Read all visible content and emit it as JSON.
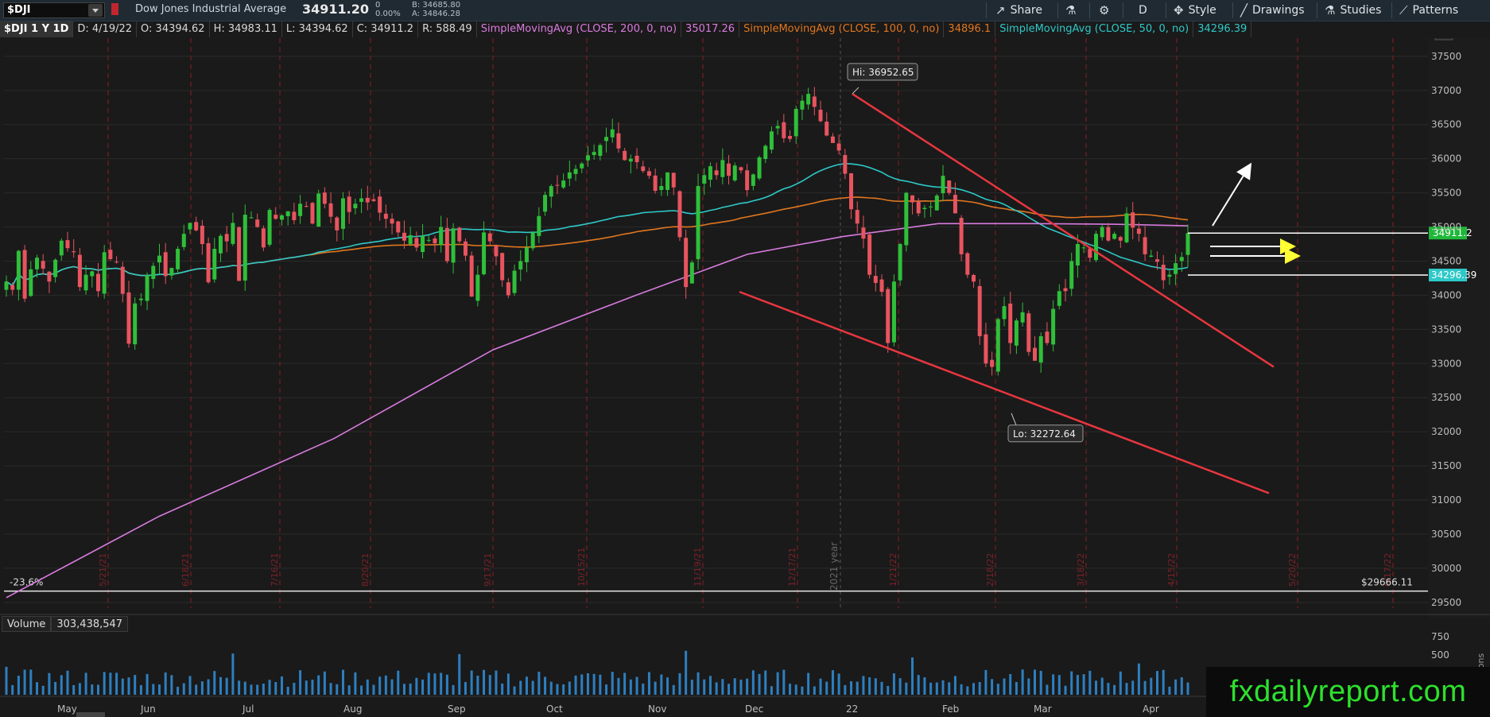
{
  "header": {
    "symbol": "$DJI",
    "name": "Dow Jones Industrial Average",
    "last": "34911.20",
    "change": "0",
    "change_pct": "0.00%",
    "bid": "B: 34685.80",
    "ask": "A: 34846.28",
    "buttons": {
      "share": "Share",
      "period": "D",
      "style": "Style",
      "drawings": "Drawings",
      "studies": "Studies",
      "patterns": "Patterns"
    }
  },
  "infobar": {
    "symbol": "$DJI 1 Y 1D",
    "date": "D: 4/19/22",
    "open": "O: 34394.62",
    "high": "H: 34983.11",
    "low": "L: 34394.62",
    "close": "C: 34911.2",
    "range": "R: 588.49",
    "sma200_label": "SimpleMovingAvg (CLOSE, 200, 0, no)",
    "sma200_value": "35017.26",
    "sma100_label": "SimpleMovingAvg (CLOSE, 100, 0, no)",
    "sma100_value": "34896.1",
    "sma50_label": "SimpleMovingAvg (CLOSE, 50, 0, no)",
    "sma50_value": "34296.39"
  },
  "volume": {
    "label": "Volume",
    "value": "303,438,547"
  },
  "watermark": "fxdailyreport.com",
  "colors": {
    "up": "#2fbf3a",
    "down": "#e8545f",
    "sma200": "#d97be0",
    "sma100": "#e0761f",
    "sma50": "#2ec8c8",
    "trend": "#e8363f",
    "volume": "#2d7fc0",
    "arrow": "#ffff33"
  },
  "chart_data": {
    "type": "candlestick",
    "y_ticks": [
      29500,
      30000,
      30500,
      31000,
      31500,
      32000,
      32500,
      33000,
      33500,
      34000,
      34500,
      35000,
      35500,
      36000,
      36500,
      37000,
      37500
    ],
    "ylim": [
      29300,
      37650
    ],
    "x_months": [
      "May",
      "Jun",
      "Jul",
      "Aug",
      "Sep",
      "Oct",
      "Nov",
      "Dec",
      "22",
      "Feb",
      "Mar",
      "Apr"
    ],
    "x_dates_vertical": [
      "5/21/21",
      "6/18/21",
      "7/16/21",
      "8/20/21",
      "9/17/21",
      "10/15/21",
      "11/19/21",
      "12/17/21",
      "1/21/22",
      "2/18/22",
      "3/18/22",
      "4/15/22",
      "5/20/22",
      "6/17/22"
    ],
    "year_marker": "2021 year",
    "high_label": "Hi: 36952.65",
    "low_label": "Lo: 32272.64",
    "fib_label": "-23.6%",
    "fib_value": "$29666.11",
    "last_price_tag": "34911.2",
    "sma50_tag": "34296.39",
    "vol_ticks": [
      "750",
      "500"
    ],
    "vol_unit": "Millions",
    "daily_closes": [
      34200,
      34080,
      34650,
      33950,
      34380,
      34550,
      34390,
      34200,
      34520,
      34800,
      34690,
      34630,
      34120,
      34300,
      34350,
      34060,
      34630,
      34530,
      34480,
      34020,
      33290,
      33880,
      33950,
      34290,
      34430,
      34580,
      34280,
      34400,
      34680,
      34900,
      35060,
      34950,
      34750,
      34190,
      34680,
      34870,
      34790,
      35060,
      34210,
      35180,
      35140,
      35000,
      34700,
      35250,
      35120,
      35170,
      35230,
      35100,
      35340,
      35300,
      35050,
      35490,
      35340,
      35150,
      34950,
      35420,
      35220,
      35340,
      35420,
      35360,
      35380,
      35210,
      35120,
      35050,
      34920,
      34800,
      34880,
      34700,
      34870,
      34810,
      34760,
      35000,
      34500,
      34980,
      34790,
      34580,
      33980,
      34300,
      34920,
      34790,
      34570,
      34220,
      34000,
      34360,
      34500,
      34700,
      34920,
      35160,
      35470,
      35600,
      35610,
      35680,
      35800,
      35850,
      35930,
      36050,
      36100,
      36200,
      36320,
      36430,
      36150,
      35980,
      36000,
      35950,
      35820,
      35750,
      35530,
      35600,
      35800,
      35580,
      34850,
      34120,
      34480,
      35600,
      35760,
      35890,
      35760,
      35980,
      35750,
      35900,
      35830,
      35540,
      35770,
      36020,
      36190,
      36400,
      36480,
      36300,
      36290,
      36730,
      36850,
      36950,
      36760,
      36550,
      36340,
      36230,
      36120,
      35780,
      35260,
      35050,
      34830,
      34300,
      34180,
      34050,
      33300,
      34200,
      34750,
      35500,
      35360,
      35200,
      35280,
      35300,
      35460,
      35750,
      35500,
      35200,
      34600,
      34300,
      34200,
      33400,
      33000,
      32950,
      33650,
      33840,
      33300,
      33630,
      33750,
      33170,
      33040,
      33400,
      33300,
      33800,
      34060,
      34060,
      34500,
      34750,
      34700,
      34550,
      34900,
      35000,
      34800,
      34900,
      34800,
      35200,
      34990,
      34900,
      34600,
      34580,
      34490,
      34220,
      34300,
      34470,
      34560,
      34910
    ]
  }
}
